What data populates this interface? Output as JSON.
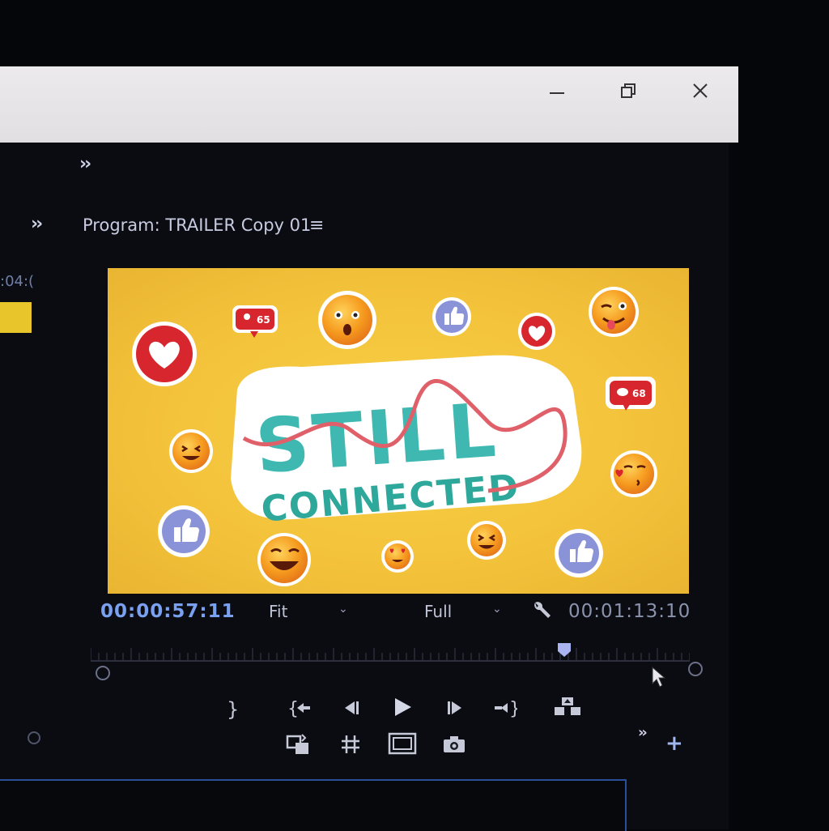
{
  "window": {
    "controls": {
      "minimize": "minimize",
      "maximize": "maximize",
      "close": "close"
    }
  },
  "panel": {
    "title": "Program: TRAILER Copy 01",
    "menu_icon": "hamburger-menu-icon",
    "overflow_icon": "double-chevron-icon",
    "left_timecode": ":04:("
  },
  "program_frame": {
    "title_line1": "STILL",
    "title_line2": "CONNECTED",
    "badge_count_1": "65",
    "badge_count_2": "68",
    "colors": {
      "background": "#f3c23a",
      "title_teal": "#3fb8b2",
      "rope": "#e0606a",
      "heart_red": "#d8262e",
      "like_blue": "#8a93d8"
    }
  },
  "controls": {
    "current_timecode": "00:00:57:11",
    "zoom_level": "Fit",
    "playback_resolution": "Full",
    "duration_timecode": "00:01:13:10",
    "playhead_position": 0.79
  },
  "transport": [
    "mark-out-icon",
    "go-to-in-icon",
    "step-back-icon",
    "play-icon",
    "step-forward-icon",
    "go-to-out-icon",
    "lift-icon",
    "loop-icon",
    "safe-margins-icon",
    "comparison-view-icon",
    "export-frame-icon",
    "add-button-icon"
  ],
  "accent": "#7aa0f0"
}
